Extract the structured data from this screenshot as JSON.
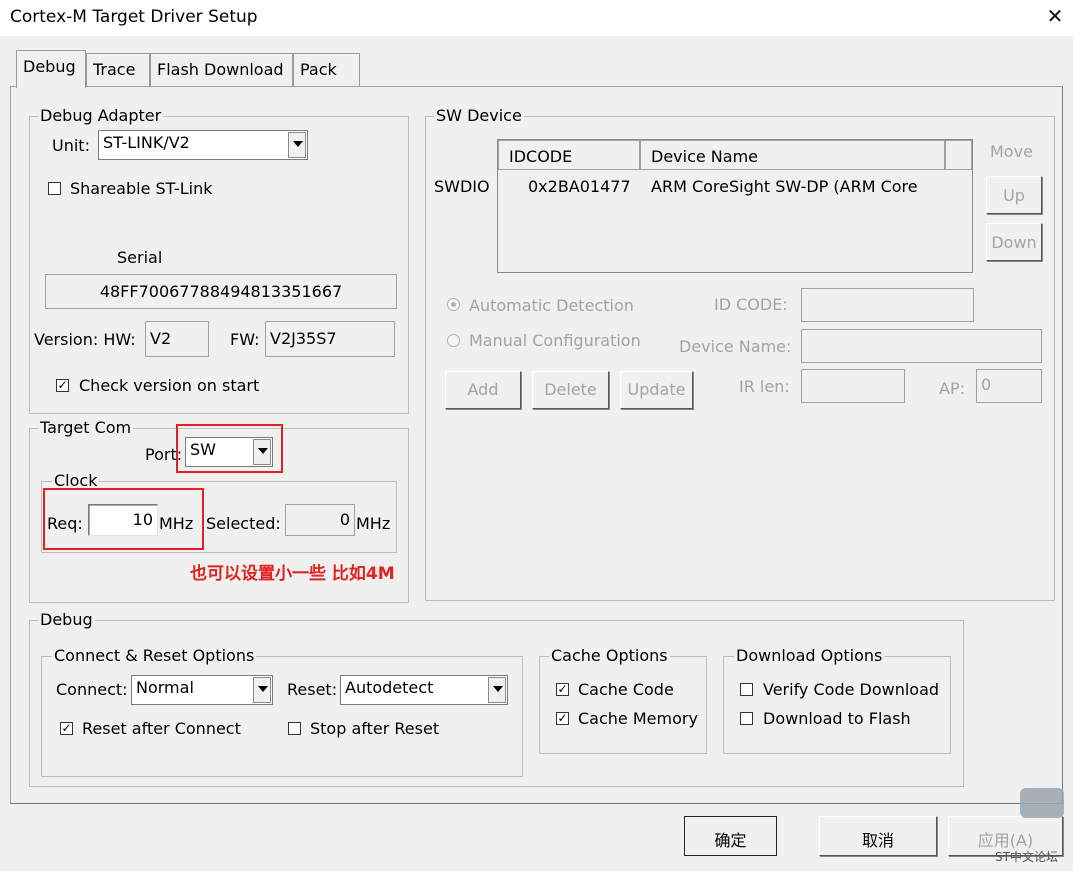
{
  "window": {
    "title": "Cortex-M Target Driver Setup",
    "close_label": "✕"
  },
  "tabs": [
    "Debug",
    "Trace",
    "Flash Download",
    "Pack"
  ],
  "debug_adapter": {
    "title": "Debug Adapter",
    "unit_label": "Unit:",
    "unit_value": "ST-LINK/V2",
    "shareable_label": "Shareable ST-Link",
    "serial_label": "Serial",
    "serial_value": "48FF70067788494813351667",
    "version_label": "Version: HW:",
    "hw_value": "V2",
    "fw_label": "FW:",
    "fw_value": "V2J35S7",
    "check_version_label": "Check version on start"
  },
  "target_com": {
    "title": "Target Com",
    "port_label": "Port:",
    "port_value": "SW",
    "clock_title": "Clock",
    "req_label": "Req:",
    "req_value": "10",
    "req_unit": "MHz",
    "selected_label": "Selected:",
    "selected_value": "0",
    "selected_unit": "MHz",
    "annotation": "也可以设置小一些 比如4M"
  },
  "sw_device": {
    "title": "SW Device",
    "row_label": "SWDIO",
    "col_idcode": "IDCODE",
    "col_device_name": "Device Name",
    "idcode_value": "0x2BA01477",
    "device_name_value": "ARM CoreSight SW-DP (ARM Core",
    "move_label": "Move",
    "up_label": "Up",
    "down_label": "Down",
    "auto_detect_label": "Automatic Detection",
    "manual_config_label": "Manual Configuration",
    "id_code_label": "ID CODE:",
    "device_name_label": "Device Name:",
    "add_label": "Add",
    "delete_label": "Delete",
    "update_label": "Update",
    "ir_len_label": "IR len:",
    "ap_label": "AP:",
    "ap_value": "0"
  },
  "debug": {
    "title": "Debug",
    "connect_reset_title": "Connect & Reset Options",
    "connect_label": "Connect:",
    "connect_value": "Normal",
    "reset_label": "Reset:",
    "reset_value": "Autodetect",
    "reset_after_connect_label": "Reset after Connect",
    "stop_after_reset_label": "Stop after Reset",
    "cache_title": "Cache Options",
    "cache_code_label": "Cache Code",
    "cache_memory_label": "Cache Memory",
    "download_title": "Download Options",
    "verify_label": "Verify Code Download",
    "download_flash_label": "Download to Flash"
  },
  "footer": {
    "ok_label": "确定",
    "cancel_label": "取消",
    "apply_label": "应用(A)",
    "watermark": "ST中文论坛"
  }
}
